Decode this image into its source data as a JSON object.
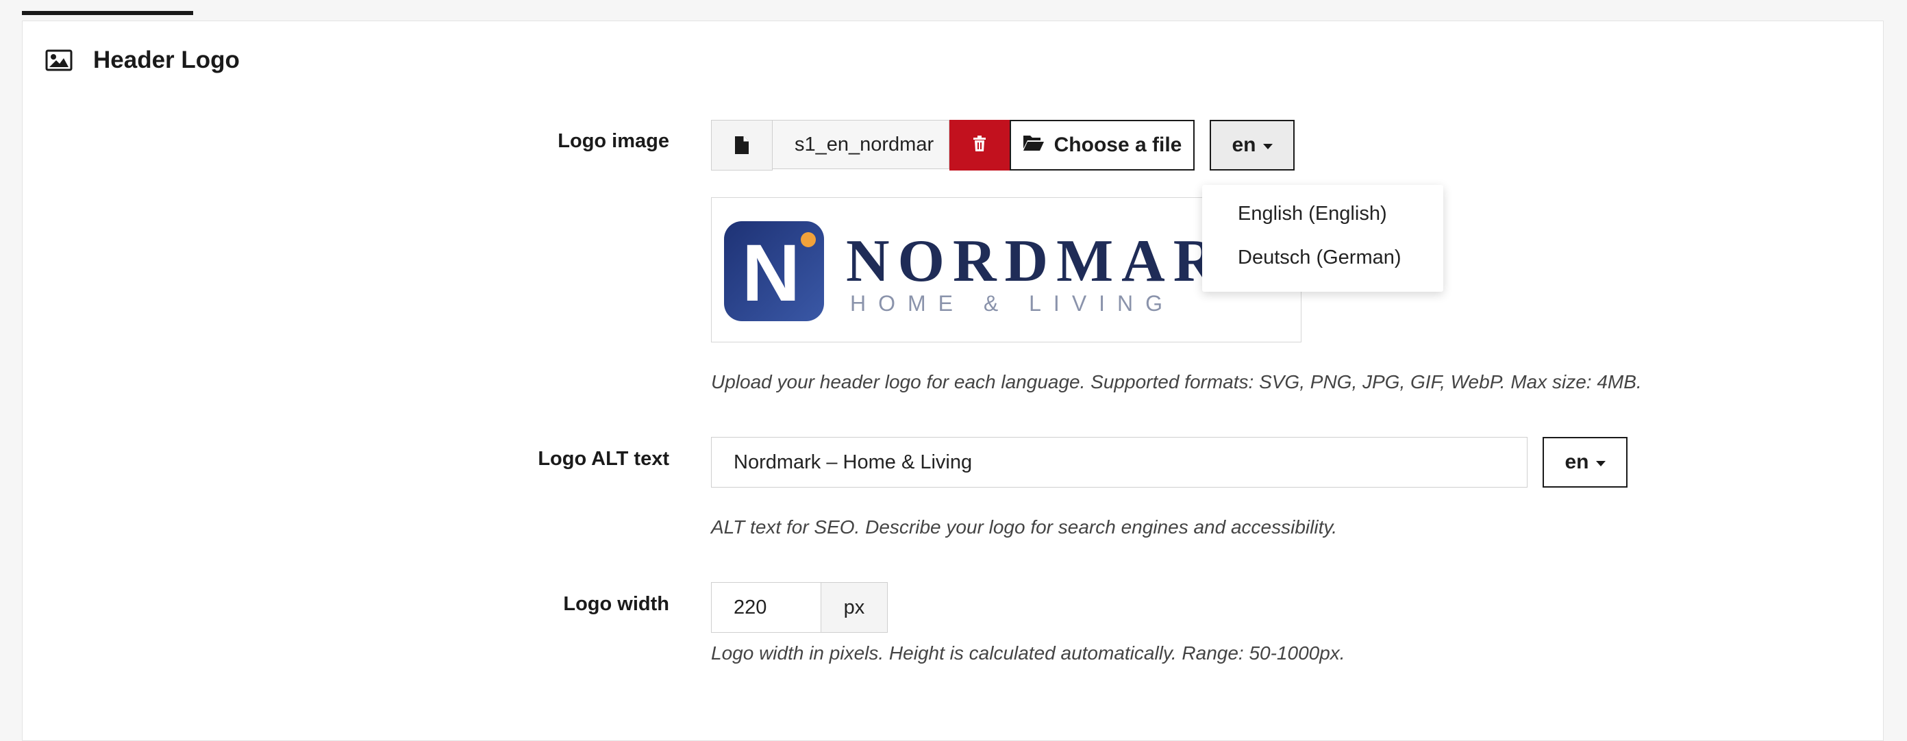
{
  "section": {
    "title": "Header Logo",
    "icon": "image-icon"
  },
  "logo_image": {
    "label": "Logo image",
    "file_name": "s1_en_nordmar",
    "choose_label": "Choose a file",
    "lang": "en",
    "dropdown_options": [
      "English (English)",
      "Deutsch (German)"
    ],
    "preview": {
      "brand": "NORDMARK",
      "badge_letter": "N",
      "tagline": "HOME & LIVING"
    },
    "help": "Upload your header logo for each language. Supported formats: SVG, PNG, JPG, GIF, WebP. Max size: 4MB."
  },
  "logo_alt": {
    "label": "Logo ALT text",
    "value": "Nordmark – Home & Living",
    "lang": "en",
    "help": "ALT text for SEO. Describe your logo for search engines and accessibility."
  },
  "logo_width": {
    "label": "Logo width",
    "value": "220",
    "unit": "px",
    "help": "Logo width in pixels. Height is calculated automatically. Range: 50-1000px."
  },
  "colors": {
    "delete_red": "#c2111e",
    "brand_navy": "#1f2c57",
    "badge_accent": "#f2a23a"
  }
}
